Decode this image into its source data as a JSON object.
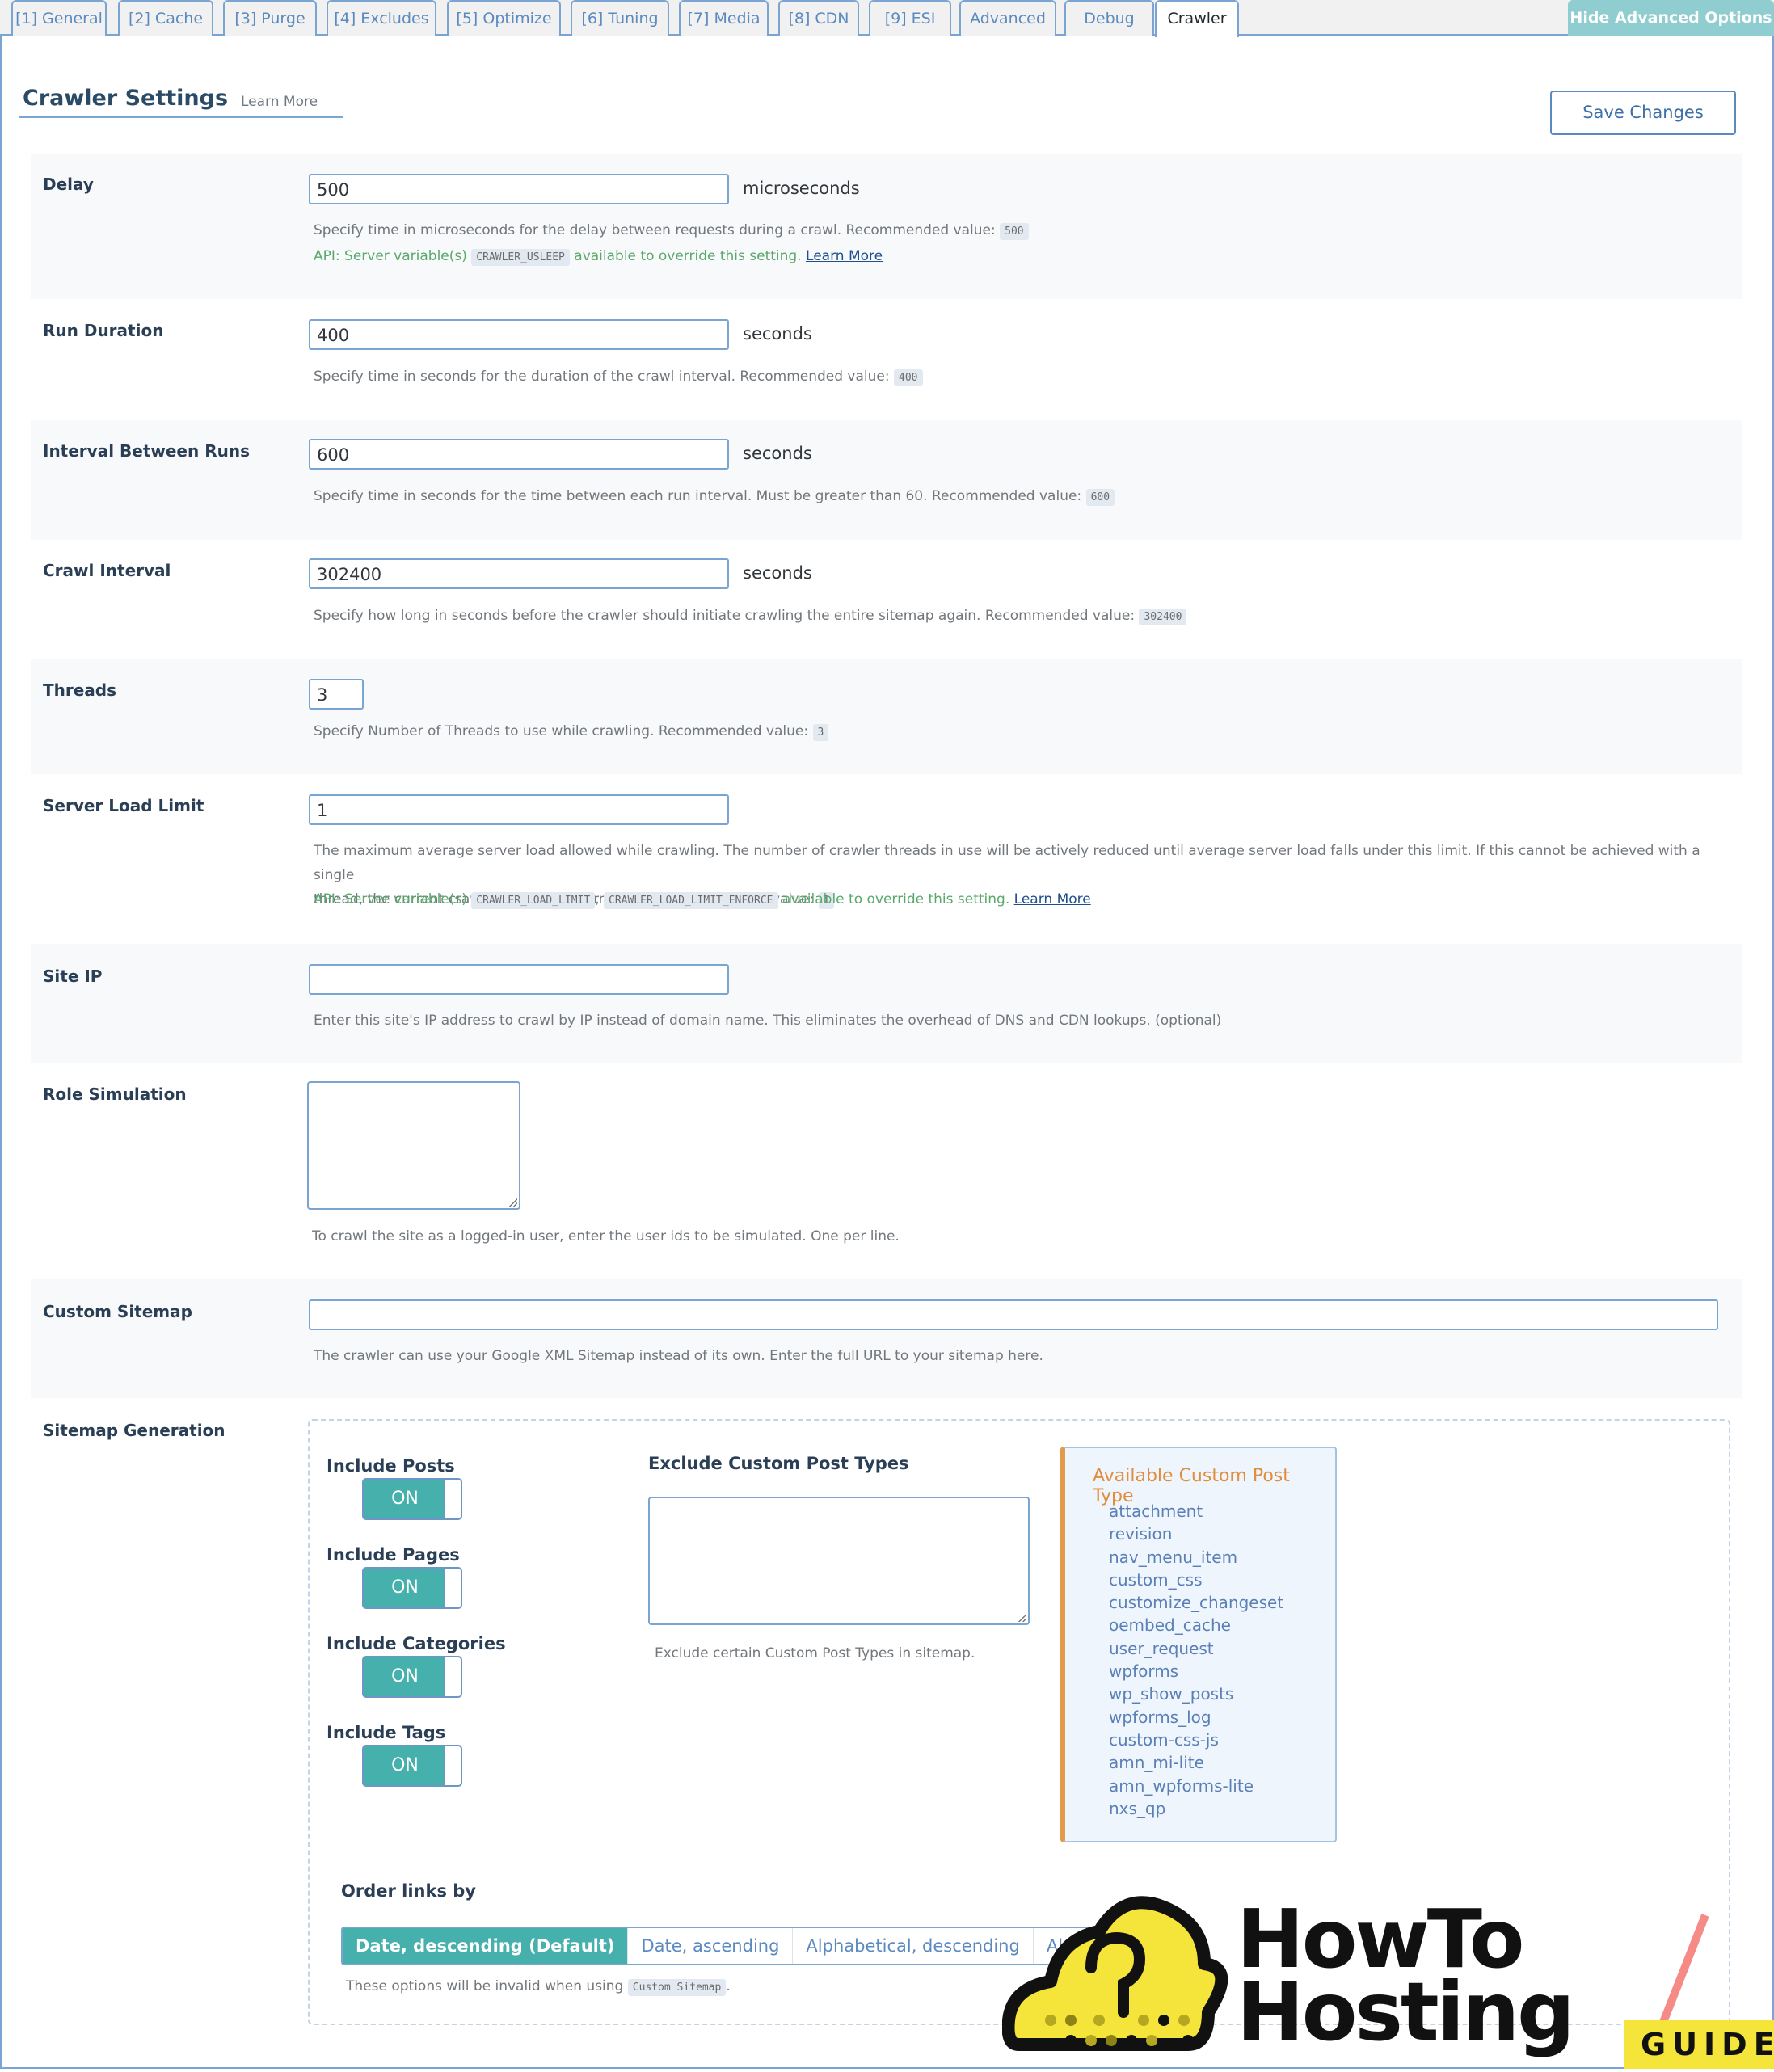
{
  "tabs": [
    {
      "label": "[1] General",
      "active": false
    },
    {
      "label": "[2] Cache",
      "active": false
    },
    {
      "label": "[3] Purge",
      "active": false
    },
    {
      "label": "[4] Excludes",
      "active": false
    },
    {
      "label": "[5] Optimize",
      "active": false
    },
    {
      "label": "[6] Tuning",
      "active": false
    },
    {
      "label": "[7] Media",
      "active": false
    },
    {
      "label": "[8] CDN",
      "active": false
    },
    {
      "label": "[9] ESI",
      "active": false
    },
    {
      "label": "Advanced",
      "active": false
    },
    {
      "label": "Debug",
      "active": false
    },
    {
      "label": "Crawler",
      "active": true
    }
  ],
  "hide_advanced_label": "Hide Advanced Options",
  "header": {
    "title": "Crawler Settings",
    "learn_more": "Learn More",
    "save_label": "Save Changes"
  },
  "fields": {
    "delay": {
      "label": "Delay",
      "value": "500",
      "unit": "microseconds",
      "desc": "Specify time in microseconds for the delay between requests during a crawl. Recommended value:",
      "recommended": "500",
      "api_prefix": "API: Server variable(s)",
      "api_vars": [
        "CRAWLER_USLEEP"
      ],
      "api_suffix": "available to override this setting.",
      "api_link": "Learn More"
    },
    "run_duration": {
      "label": "Run Duration",
      "value": "400",
      "unit": "seconds",
      "desc": "Specify time in seconds for the duration of the crawl interval. Recommended value:",
      "recommended": "400"
    },
    "interval_between_runs": {
      "label": "Interval Between Runs",
      "value": "600",
      "unit": "seconds",
      "desc": "Specify time in seconds for the time between each run interval. Must be greater than 60. Recommended value:",
      "recommended": "600"
    },
    "crawl_interval": {
      "label": "Crawl Interval",
      "value": "302400",
      "unit": "seconds",
      "desc": "Specify how long in seconds before the crawler should initiate crawling the entire sitemap again. Recommended value:",
      "recommended": "302400"
    },
    "threads": {
      "label": "Threads",
      "value": "3",
      "desc": "Specify Number of Threads to use while crawling. Recommended value:",
      "recommended": "3"
    },
    "server_load_limit": {
      "label": "Server Load Limit",
      "value": "1",
      "desc_line1": "The maximum average server load allowed while crawling. The number of crawler threads in use will be actively reduced until average server load falls under this limit. If this cannot be achieved with a single",
      "desc_line2": "thread, the current crawler run will be terminated. Recommended value:",
      "recommended": "1",
      "api_prefix": "API: Server variable(s)",
      "api_vars": [
        "CRAWLER_LOAD_LIMIT",
        "CRAWLER_LOAD_LIMIT_ENFORCE"
      ],
      "api_sep": ",",
      "api_suffix": "available to override this setting.",
      "api_link": "Learn More"
    },
    "site_ip": {
      "label": "Site IP",
      "value": "",
      "desc": "Enter this site's IP address to crawl by IP instead of domain name. This eliminates the overhead of DNS and CDN lookups. (optional)"
    },
    "role_simulation": {
      "label": "Role Simulation",
      "value": "",
      "desc": "To crawl the site as a logged-in user, enter the user ids to be simulated. One per line."
    },
    "custom_sitemap": {
      "label": "Custom Sitemap",
      "value": "",
      "desc": "The crawler can use your Google XML Sitemap instead of its own. Enter the full URL to your sitemap here."
    }
  },
  "sitemap_generation": {
    "label": "Sitemap Generation",
    "toggles": [
      {
        "label": "Include Posts",
        "state": "ON"
      },
      {
        "label": "Include Pages",
        "state": "ON"
      },
      {
        "label": "Include Categories",
        "state": "ON"
      },
      {
        "label": "Include Tags",
        "state": "ON"
      }
    ],
    "exclude_cpt": {
      "label": "Exclude Custom Post Types",
      "value": "",
      "desc": "Exclude certain Custom Post Types in sitemap."
    },
    "available_cpt": {
      "title": "Available Custom Post Type",
      "items": [
        "attachment",
        "revision",
        "nav_menu_item",
        "custom_css",
        "customize_changeset",
        "oembed_cache",
        "user_request",
        "wpforms",
        "wp_show_posts",
        "wpforms_log",
        "custom-css-js",
        "amn_mi-lite",
        "amn_wpforms-lite",
        "nxs_qp"
      ]
    },
    "order": {
      "label": "Order links by",
      "options": [
        "Date, descending (Default)",
        "Date, ascending",
        "Alphabetical, descending",
        "Alphabetical, ascending"
      ],
      "selected": "Date, descending (Default)",
      "note_prefix": "These options will be invalid when using",
      "note_code": "Custom Sitemap",
      "note_suffix": "."
    }
  },
  "watermark": {
    "line1": "HowTo",
    "line2": "Hosting",
    "badge": "GUIDE"
  },
  "colors": {
    "accent_teal": "#45b0ac",
    "tab_border": "#7aa5d2",
    "link_blue": "#5b8ac1",
    "api_green": "#5aa86b",
    "cpt_orange": "#e39b4b"
  }
}
